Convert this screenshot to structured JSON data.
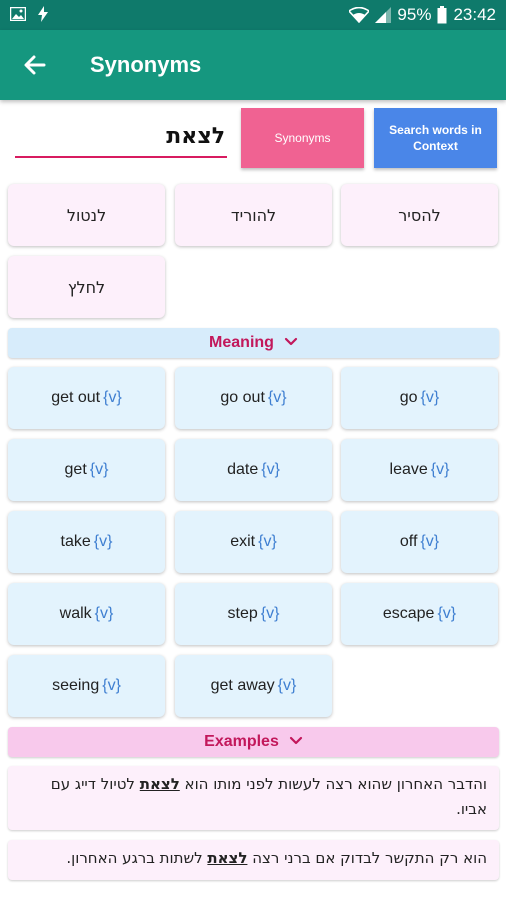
{
  "status_bar": {
    "battery": "95%",
    "time": "23:42"
  },
  "app_bar": {
    "title": "Synonyms"
  },
  "search": {
    "value": "לצאת",
    "synonyms_button": "Synonyms",
    "context_button": "Search words in Context"
  },
  "hebrew_synonyms": [
    "להסיר",
    "להוריד",
    "לנטול",
    "לחלץ"
  ],
  "meaning": {
    "header": "Meaning",
    "items": [
      {
        "word": "go",
        "pos": "{v}"
      },
      {
        "word": "go out",
        "pos": "{v}"
      },
      {
        "word": "get out",
        "pos": "{v}"
      },
      {
        "word": "leave",
        "pos": "{v}"
      },
      {
        "word": "date",
        "pos": "{v}"
      },
      {
        "word": "get",
        "pos": "{v}"
      },
      {
        "word": "off",
        "pos": "{v}"
      },
      {
        "word": "exit",
        "pos": "{v}"
      },
      {
        "word": "take",
        "pos": "{v}"
      },
      {
        "word": "escape",
        "pos": "{v}"
      },
      {
        "word": "step",
        "pos": "{v}"
      },
      {
        "word": "walk",
        "pos": "{v}"
      },
      {
        "word": "get away",
        "pos": "{v}"
      },
      {
        "word": "seeing",
        "pos": "{v}"
      }
    ]
  },
  "examples": {
    "header": "Examples",
    "items": [
      {
        "before": "והדבר האחרון שהוא רצה לעשות לפני מותו הוא ",
        "keyword": "לצאת",
        "after": " לטיול דייג עם אביו."
      },
      {
        "before": "הוא רק התקשר לבדוק אם ברני רצה ",
        "keyword": "לצאת",
        "after": " לשתות ברגע האחרון."
      }
    ]
  },
  "colors": {
    "primary": "#15977f",
    "status": "#0f7a6b",
    "accent": "#d81b60",
    "synonyms_button": "#f06292",
    "context_button": "#4a86e8"
  }
}
